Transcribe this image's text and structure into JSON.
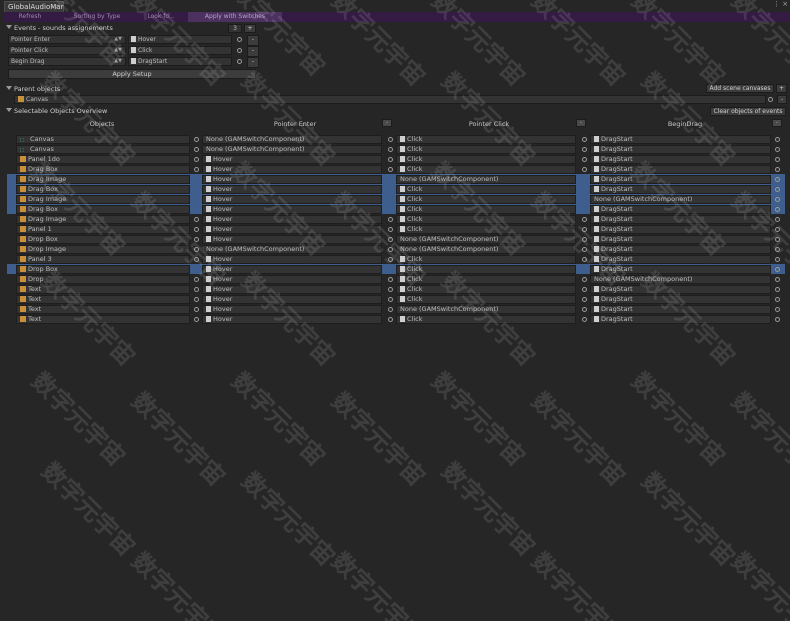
{
  "window": {
    "tab_title": "GlobalAudioMar",
    "controls": "⋮ ×"
  },
  "toolbar": {
    "items": [
      {
        "label": "Refresh",
        "active": false
      },
      {
        "label": "Sorting by Type",
        "active": false
      },
      {
        "label": "Look fo...",
        "active": false
      },
      {
        "label": "Apply with Switches",
        "active": true
      }
    ]
  },
  "events_section": {
    "title": "Events - sounds assignements",
    "count": "3",
    "add_label": "+",
    "rows": [
      {
        "event": "Pointer Enter",
        "sound": "Hover",
        "icon": "audio-clip-icon"
      },
      {
        "event": "Pointer Click",
        "sound": "Click",
        "icon": "audio-clip-icon"
      },
      {
        "event": "Begin Drag",
        "sound": "DragStart",
        "icon": "audio-clip-icon"
      }
    ],
    "remove_label": "-",
    "apply_label": "Apply Setup"
  },
  "parent_section": {
    "title": "Parent objects",
    "add_label": "Add scene canvases",
    "add_plus": "+",
    "field_value": "Canvas"
  },
  "overview": {
    "title": "Selectable Objects Overview",
    "clear_label": "Clear objects of events",
    "columns": [
      "Objects",
      "Pointer Enter",
      "Pointer Click",
      "BeginDrag"
    ],
    "col_menu": "–",
    "rows": [
      {
        "object": "Canvas",
        "obj_icon": "canvas",
        "enter": "None (GAMSwitchComponent)",
        "click": "Click",
        "drag": "DragStart",
        "hl": []
      },
      {
        "object": "Canvas",
        "obj_icon": "canvas",
        "enter": "None (GAMSwitchComponent)",
        "click": "Click",
        "drag": "DragStart",
        "hl": []
      },
      {
        "object": "Panel 1do",
        "obj_icon": "go",
        "enter": "Hover",
        "click": "Click",
        "drag": "DragStart",
        "hl": []
      },
      {
        "object": "Drag Box",
        "obj_icon": "go",
        "enter": "Hover",
        "click": "Click",
        "drag": "DragStart",
        "hl": []
      },
      {
        "object": "Drag Image",
        "obj_icon": "go",
        "enter": "Hover",
        "click": "None (GAMSwitchComponent)",
        "drag": "DragStart",
        "hl": [
          "obj",
          "enter",
          "click",
          "drag"
        ]
      },
      {
        "object": "Drag Box",
        "obj_icon": "go",
        "enter": "Hover",
        "click": "Click",
        "drag": "DragStart",
        "hl": [
          "obj",
          "enter",
          "click",
          "drag"
        ]
      },
      {
        "object": "Drag Image",
        "obj_icon": "go",
        "enter": "Hover",
        "click": "Click",
        "drag": "None (GAMSwitchComponent)",
        "hl": [
          "obj",
          "enter",
          "click",
          "drag"
        ]
      },
      {
        "object": "Drag Box",
        "obj_icon": "go",
        "enter": "Hover",
        "click": "Click",
        "drag": "DragStart",
        "hl": [
          "obj",
          "enter",
          "click",
          "drag"
        ]
      },
      {
        "object": "Drag Image",
        "obj_icon": "go",
        "enter": "Hover",
        "click": "Click",
        "drag": "DragStart",
        "hl": []
      },
      {
        "object": "Panel 1",
        "obj_icon": "go",
        "enter": "Hover",
        "click": "Click",
        "drag": "DragStart",
        "hl": []
      },
      {
        "object": "Drop Box",
        "obj_icon": "go",
        "enter": "Hover",
        "click": "None (GAMSwitchComponent)",
        "drag": "DragStart",
        "hl": []
      },
      {
        "object": "Drop Image",
        "obj_icon": "go",
        "enter": "None (GAMSwitchComponent)",
        "click": "None (GAMSwitchComponent)",
        "drag": "DragStart",
        "hl": []
      },
      {
        "object": "Panel 3",
        "obj_icon": "go",
        "enter": "Hover",
        "click": "Click",
        "drag": "DragStart",
        "hl": []
      },
      {
        "object": "Drop Box",
        "obj_icon": "go",
        "enter": "Hover",
        "click": "Click",
        "drag": "DragStart",
        "hl": [
          "obj",
          "enter",
          "click",
          "drag"
        ]
      },
      {
        "object": "Drop",
        "obj_icon": "go",
        "enter": "Hover",
        "click": "Click",
        "drag": "None (GAMSwitchComponent)",
        "hl": []
      },
      {
        "object": "Text",
        "obj_icon": "go",
        "enter": "Hover",
        "click": "Click",
        "drag": "DragStart",
        "hl": []
      },
      {
        "object": "Text",
        "obj_icon": "go",
        "enter": "Hover",
        "click": "Click",
        "drag": "DragStart",
        "hl": []
      },
      {
        "object": "Text",
        "obj_icon": "go",
        "enter": "Hover",
        "click": "None (GAMSwitchComponent)",
        "drag": "DragStart",
        "hl": []
      },
      {
        "object": "Text",
        "obj_icon": "go",
        "enter": "Hover",
        "click": "Click",
        "drag": "DragStart",
        "hl": []
      }
    ]
  },
  "watermark": "数字元宇宙",
  "colors": {
    "highlight": "#3e5f8e",
    "toolbar": "#341b44",
    "background": "#262626"
  }
}
